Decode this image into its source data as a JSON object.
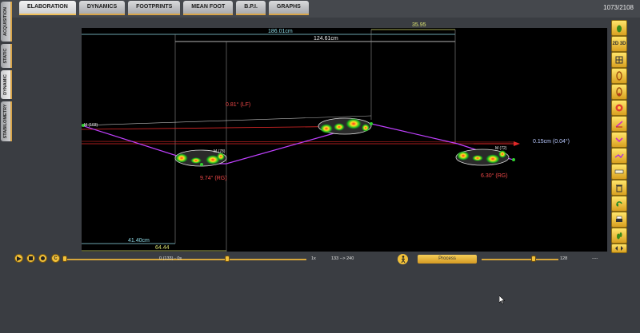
{
  "header": {
    "tabs": [
      {
        "label": "ELABORATION",
        "active": true
      },
      {
        "label": "DYNAMICS"
      },
      {
        "label": "FOOTPRINTS"
      },
      {
        "label": "MEAN FOOT"
      },
      {
        "label": "B.P.I."
      },
      {
        "label": "GRAPHS"
      }
    ],
    "frame_counter": "1073/2108"
  },
  "side_tabs": [
    "ACQUISITION",
    "STATIC",
    "DYNAMIC",
    "STABILOMETRY"
  ],
  "plot": {
    "measurements": {
      "total_length": "186.01cm",
      "stride": "124.61cm",
      "step_top": "35.95",
      "step_bottom_left": "41.40cm",
      "step_bottom_yellow": "64.44"
    },
    "angles": {
      "lf": "0.81° (LF)",
      "rg1": "9.74° (RG)",
      "rg2": "6.30° (RG)",
      "offset": "0.15cm (0.04°)"
    },
    "markers": {
      "m1": "M (103)",
      "m2": "M (78)",
      "m3": "M (72)"
    },
    "colors": {
      "trajectory": "#c040ff",
      "reference": "#e02828",
      "measure_cyan": "#8fdce8",
      "measure_yellow": "#d8e070"
    }
  },
  "toolbar_icons": [
    "foot-icon",
    "2d-3d-icon",
    "grid-icon",
    "foot-outline-icon",
    "heel-icon",
    "target-icon",
    "angle-icon",
    "bend-icon",
    "walk-path-icon",
    "ruler-icon",
    "trash-icon",
    "back-icon",
    "print-icon",
    "footprint-icon",
    "scroll-arrows-icon"
  ],
  "toolbar_labels": {
    "view_2d3d": "2D 3D"
  },
  "controls": {
    "frame_readout": "0 (133) - 0s",
    "speed": "1x",
    "range": "133 --> 240",
    "process_label": "Process",
    "threshold": "128",
    "threshold_level": 0.68,
    "dots": "----"
  }
}
